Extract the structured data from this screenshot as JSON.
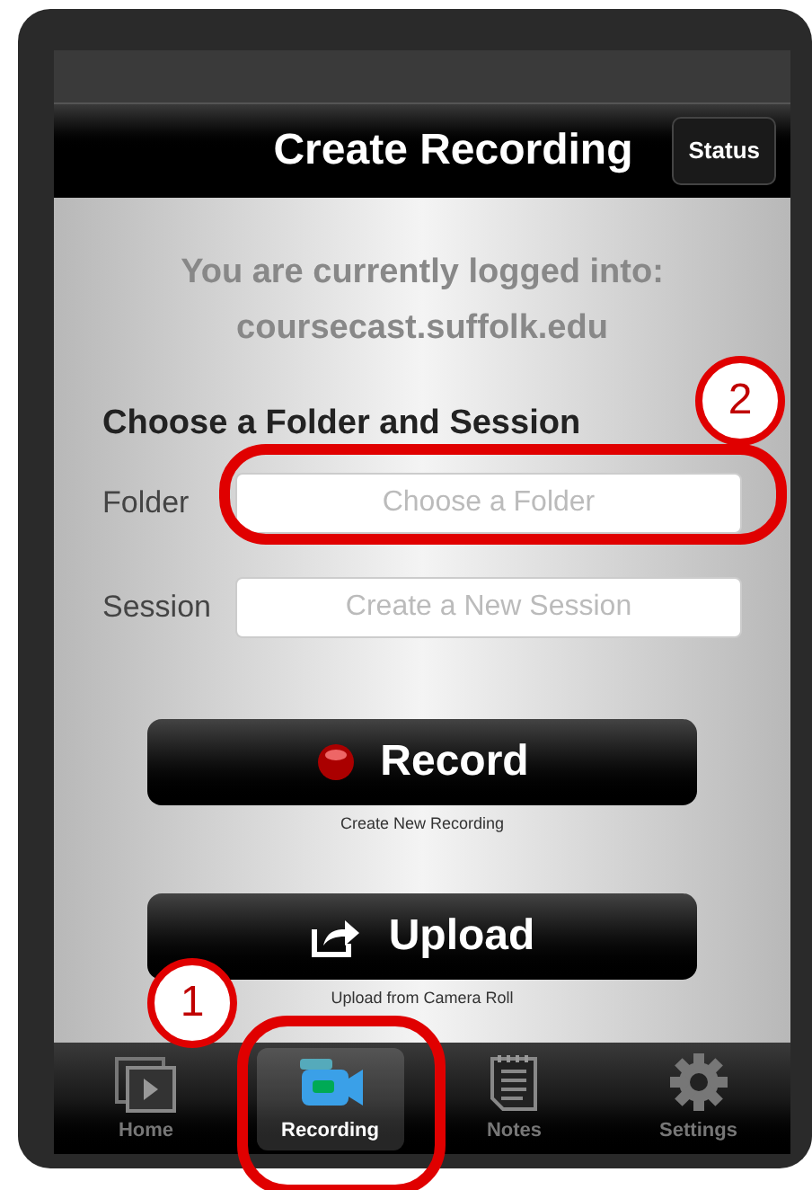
{
  "nav_bar": {
    "title": "Create Recording",
    "button": "Status"
  },
  "login": {
    "line_1": "You are currently logged into:",
    "line_2": "coursecast.suffolk.edu"
  },
  "section_title": "Choose a Folder and Session",
  "fields": [
    {
      "label": "Folder",
      "placeholder": "Choose a Folder",
      "highlighted": true,
      "callout": "2"
    },
    {
      "label": "Session",
      "placeholder": "Create a New Session",
      "highlighted": false
    }
  ],
  "actions": [
    {
      "kind": "record",
      "label": "Record",
      "caption": "Create New Recording"
    },
    {
      "kind": "upload",
      "label": "Upload",
      "caption": "Upload from Camera Roll"
    }
  ],
  "tab_bar": [
    {
      "kind": "home",
      "label": "Home",
      "selected": false,
      "highlighted": false
    },
    {
      "kind": "recording",
      "label": "Recording",
      "selected": true,
      "highlighted": true,
      "callout": "1"
    },
    {
      "kind": "notes",
      "label": "Notes",
      "selected": false,
      "highlighted": false
    },
    {
      "kind": "settings",
      "label": "Settings",
      "selected": false,
      "highlighted": false
    }
  ]
}
